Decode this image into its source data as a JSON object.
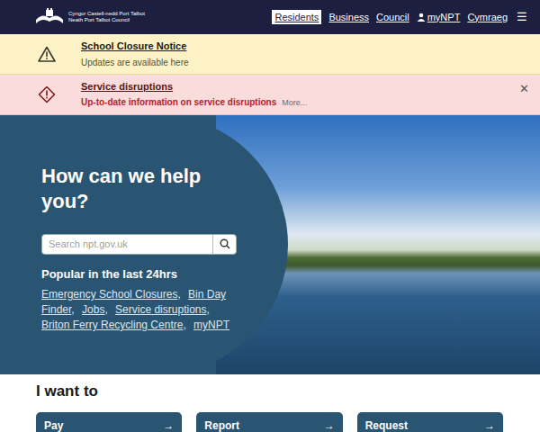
{
  "header": {
    "logo": {
      "line1": "Cyngor Castell-nedd Port Talbot",
      "line2": "Neath Port Talbot Council"
    },
    "nav": [
      {
        "label": "Residents",
        "selected": true,
        "kind": "link"
      },
      {
        "label": "Business",
        "selected": false,
        "kind": "link"
      },
      {
        "label": "Council",
        "selected": false,
        "kind": "link"
      },
      {
        "label": "myNPT",
        "selected": false,
        "kind": "account"
      },
      {
        "label": "Cymraeg",
        "selected": false,
        "kind": "link"
      }
    ],
    "menu": "☰"
  },
  "alerts": [
    {
      "kind": "warning",
      "title": "School Closure Notice",
      "text": "Updates are available here"
    },
    {
      "kind": "error",
      "title": "Service disruptions",
      "text": "Up-to-date information on service disruptions",
      "more": "More...",
      "close": "✕"
    }
  ],
  "hero": {
    "heading": "How can we help you?",
    "search": {
      "placeholder": "Search npt.gov.uk"
    },
    "popular": {
      "title": "Popular in the last 24hrs",
      "separator": ",",
      "links": [
        "Emergency School Closures",
        "Bin Day Finder",
        "Jobs",
        "Service disruptions",
        "Briton Ferry Recycling Centre",
        "myNPT"
      ]
    }
  },
  "i_want_to": {
    "title": "I want to",
    "cards": [
      {
        "label": "Pay",
        "arrow": "→"
      },
      {
        "label": "Report",
        "arrow": "→"
      },
      {
        "label": "Request",
        "arrow": "→"
      }
    ]
  }
}
